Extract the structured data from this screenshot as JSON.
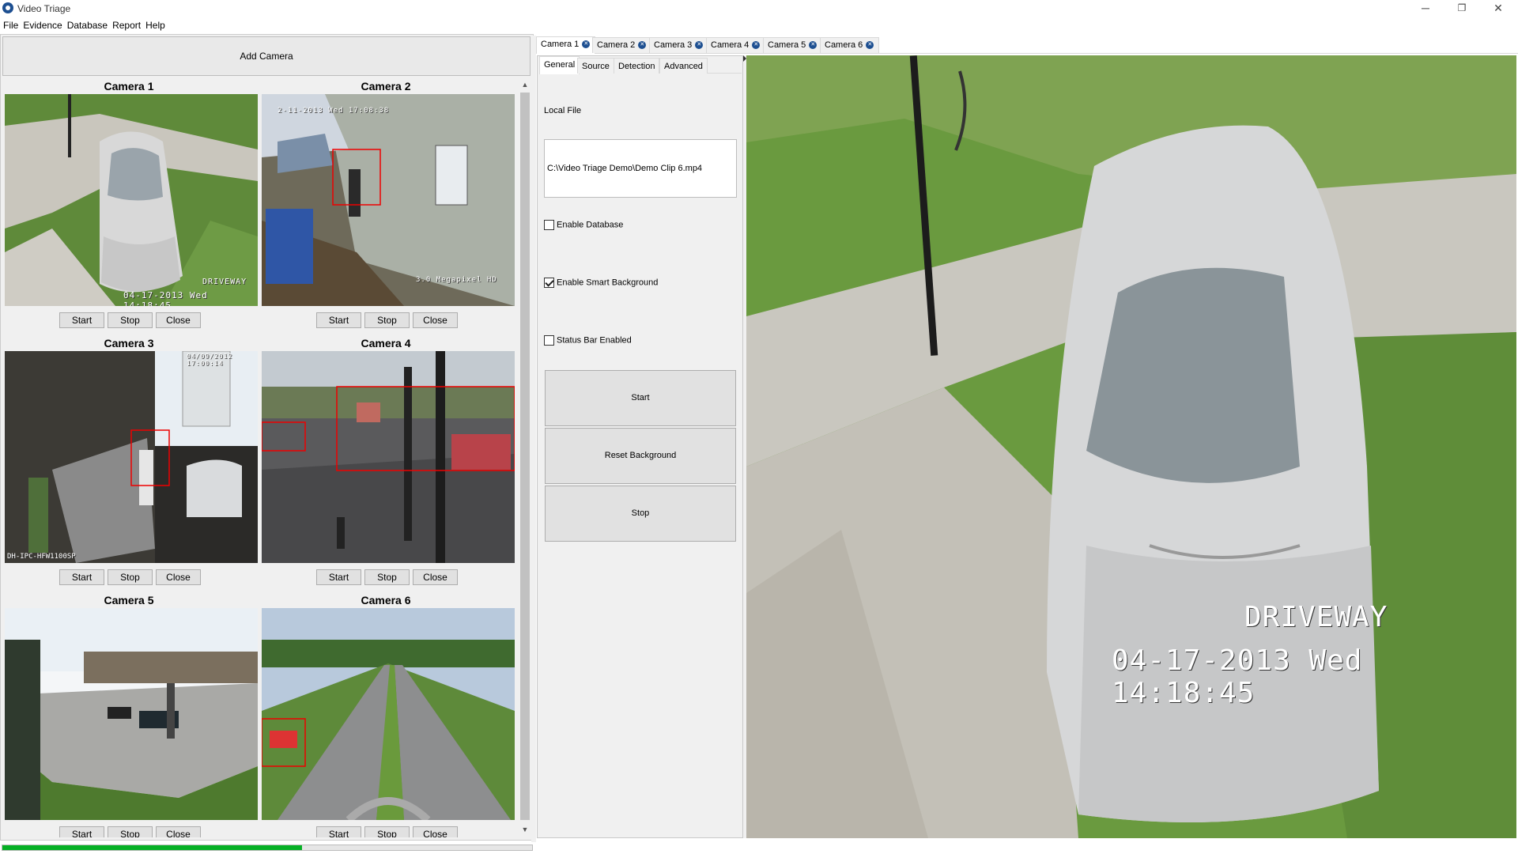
{
  "window": {
    "title": "Video Triage",
    "minimize": "─",
    "maximize": "❐",
    "close": "✕"
  },
  "menu": [
    "File",
    "Evidence",
    "Database",
    "Report",
    "Help"
  ],
  "left_panel": {
    "add_camera_label": "Add Camera",
    "progress_fraction": 0.565,
    "progress_color": "#06b025",
    "cameras": [
      {
        "title": "Camera 1",
        "overlay_top": "",
        "overlay_label": "DRIVEWAY",
        "overlay_bottom": "04-17-2013 Wed 14:18:45"
      },
      {
        "title": "Camera 2",
        "overlay_top": "2-11-2013 Wed 17:08:38",
        "overlay_label": "",
        "overlay_bottom": "3.0 Megapixel HD"
      },
      {
        "title": "Camera 3",
        "overlay_top": "04/09/2012 17:00:14",
        "overlay_label": "",
        "overlay_bottom": "DH-IPC-HFW1100SP"
      },
      {
        "title": "Camera 4",
        "overlay_top": "",
        "overlay_label": "",
        "overlay_bottom": ""
      },
      {
        "title": "Camera 5",
        "overlay_top": "",
        "overlay_label": "",
        "overlay_bottom": ""
      },
      {
        "title": "Camera 6",
        "overlay_top": "",
        "overlay_label": "",
        "overlay_bottom": ""
      }
    ],
    "buttons": {
      "start": "Start",
      "stop": "Stop",
      "close": "Close"
    }
  },
  "camera_tabs": [
    "Camera 1",
    "Camera 2",
    "Camera 3",
    "Camera 4",
    "Camera 5",
    "Camera 6"
  ],
  "active_camera_tab": "Camera 1",
  "settings": {
    "sub_tabs": [
      "General",
      "Source",
      "Detection",
      "Advanced"
    ],
    "active_sub_tab": "General",
    "local_file_label": "Local File",
    "local_file_value": "C:\\Video Triage Demo\\Demo Clip 6.mp4",
    "enable_database_label": "Enable Database",
    "enable_database_checked": false,
    "smart_background_label": "Enable Smart Background",
    "smart_background_checked": true,
    "status_bar_label": "Status Bar Enabled",
    "status_bar_checked": false,
    "start_label": "Start",
    "reset_background_label": "Reset Background",
    "stop_label": "Stop"
  },
  "preview": {
    "overlay_label": "DRIVEWAY",
    "overlay_timestamp": "04-17-2013 Wed 14:18:45"
  }
}
